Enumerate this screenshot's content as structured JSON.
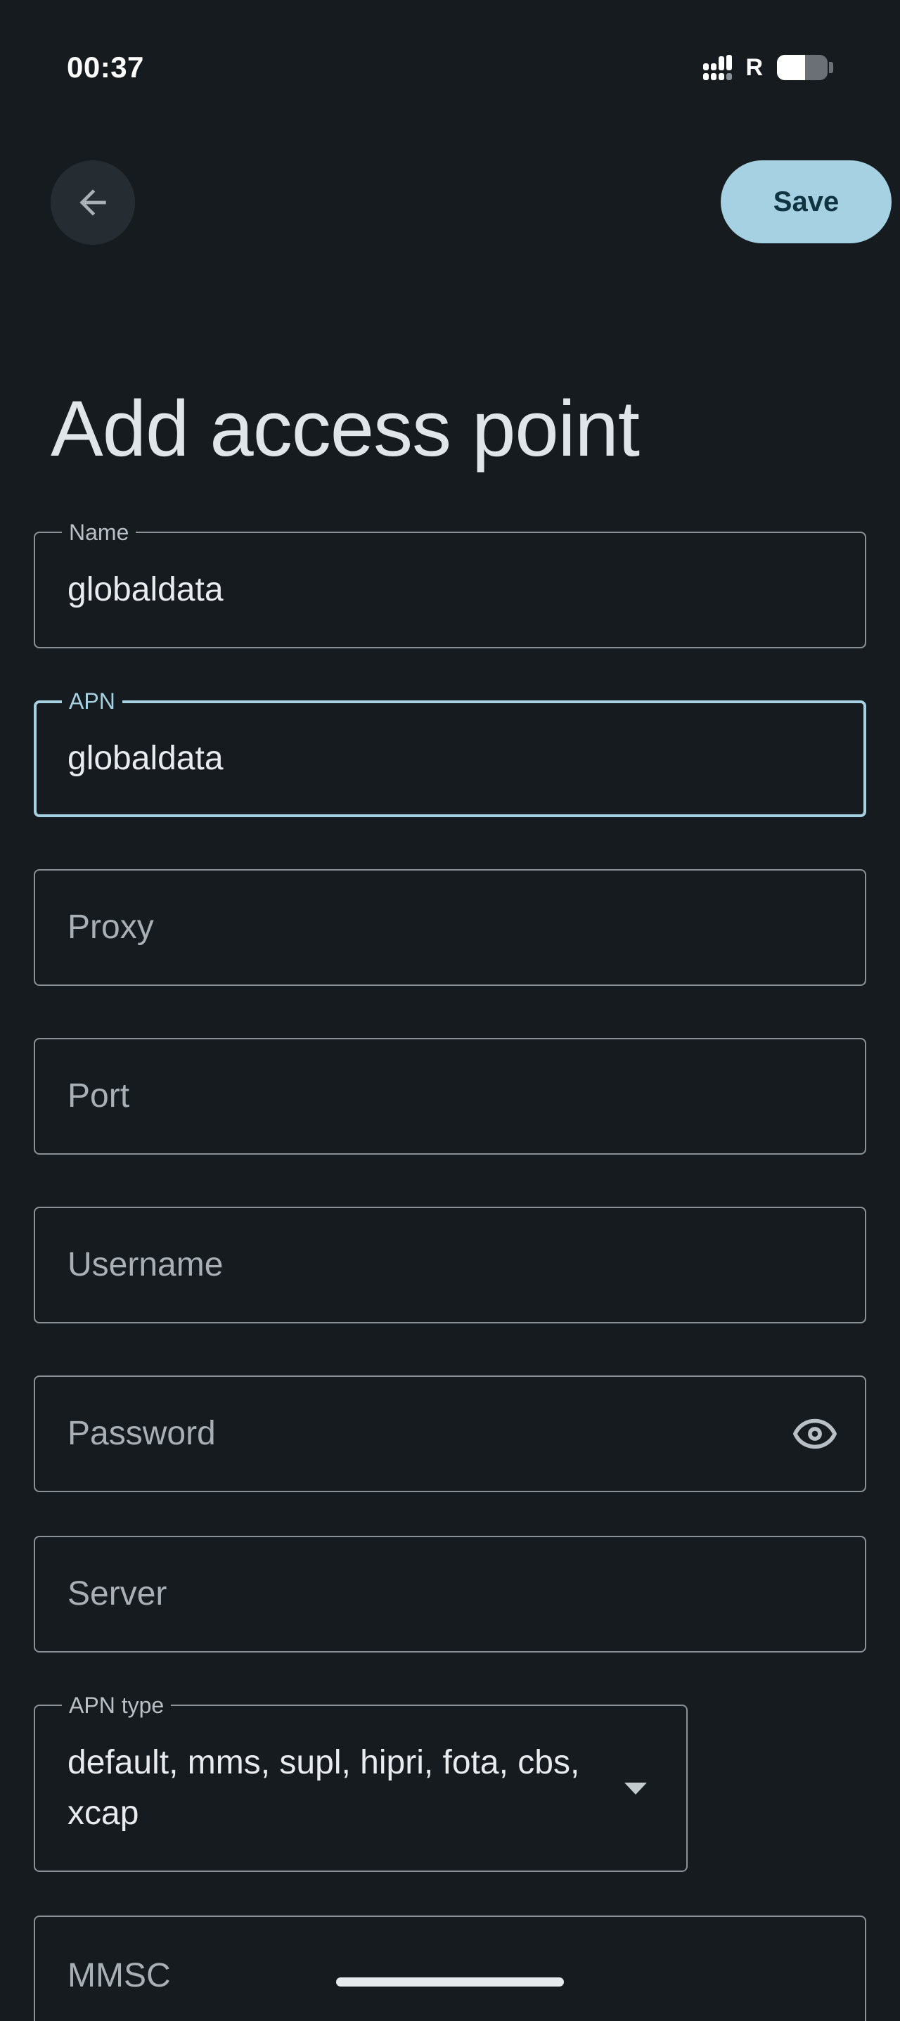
{
  "status_bar": {
    "time": "00:37",
    "roaming": "R",
    "battery_level": 0.55
  },
  "toolbar": {
    "back_icon": "arrow-back-icon",
    "save_label": "Save"
  },
  "page": {
    "title": "Add access point"
  },
  "fields": {
    "name": {
      "label": "Name",
      "value": "globaldata"
    },
    "apn": {
      "label": "APN",
      "value": "globaldata"
    },
    "proxy": {
      "placeholder": "Proxy"
    },
    "port": {
      "placeholder": "Port"
    },
    "username": {
      "placeholder": "Username"
    },
    "password": {
      "placeholder": "Password",
      "toggle_icon": "eye-icon"
    },
    "server": {
      "placeholder": "Server"
    },
    "apn_type": {
      "label": "APN type",
      "value": "default, mms, supl, hipri, fota, cbs, xcap"
    },
    "mmsc": {
      "placeholder": "MMSC"
    }
  },
  "colors": {
    "background": "#151b1f",
    "accent": "#a5d1e3",
    "outline": "#8b9297"
  }
}
